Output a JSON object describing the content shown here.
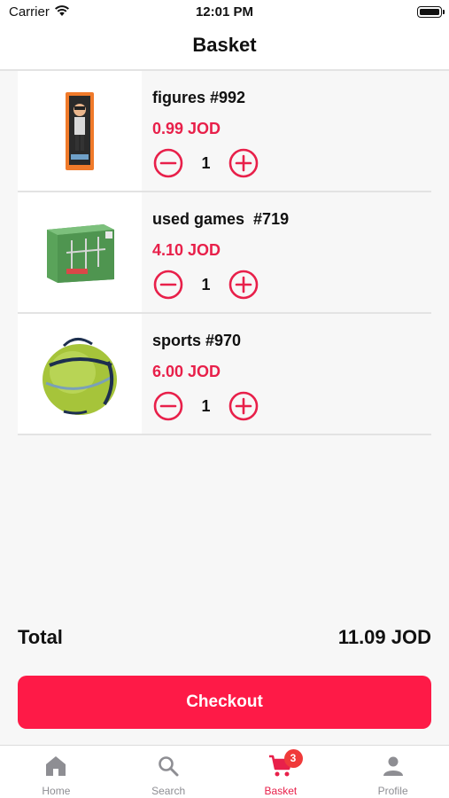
{
  "status_bar": {
    "carrier": "Carrier",
    "time": "12:01 PM"
  },
  "header": {
    "title": "Basket"
  },
  "basket": {
    "items": [
      {
        "name": "figures #992",
        "price": "0.99 JOD",
        "quantity": "1",
        "image": "boxed-figure-toy"
      },
      {
        "name": "used games  #719",
        "price": "4.10 JOD",
        "quantity": "1",
        "image": "boxed-goal-game"
      },
      {
        "name": "sports #970",
        "price": "6.00 JOD",
        "quantity": "1",
        "image": "green-pop-up-ball"
      }
    ]
  },
  "summary": {
    "total_label": "Total",
    "total_value": "11.09 JOD",
    "checkout_label": "Checkout"
  },
  "tabbar": {
    "tabs": [
      {
        "label": "Home",
        "icon": "home-icon",
        "active": false
      },
      {
        "label": "Search",
        "icon": "search-icon",
        "active": false
      },
      {
        "label": "Basket",
        "icon": "cart-icon",
        "active": true,
        "badge": "3"
      },
      {
        "label": "Profile",
        "icon": "person-icon",
        "active": false
      }
    ]
  },
  "colors": {
    "accent": "#e8204a",
    "checkout_bg": "#fe1a47",
    "badge": "#f03a3a",
    "inactive": "#8e8e93"
  }
}
